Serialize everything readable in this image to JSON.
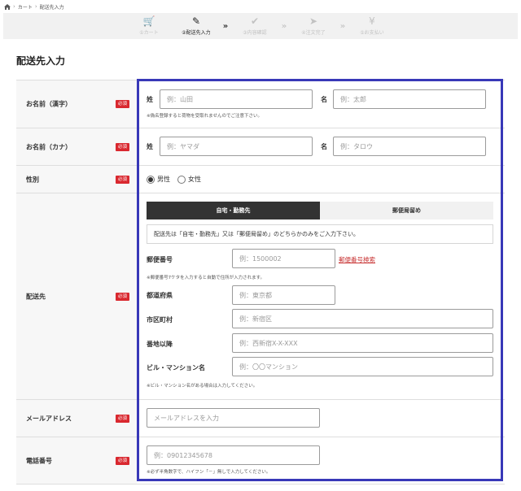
{
  "breadcrumb": {
    "home_icon": "home-icon",
    "cart": "カート",
    "current": "配送先入力"
  },
  "steps": [
    {
      "icon": "cart-icon",
      "glyph": "🛒",
      "label": "①カート"
    },
    {
      "icon": "edit-icon",
      "glyph": "✎",
      "label": "②配送先入力"
    },
    {
      "icon": "check-icon",
      "glyph": "✔",
      "label": "③内容確認"
    },
    {
      "icon": "send-icon",
      "glyph": "➤",
      "label": "④注文完了"
    },
    {
      "icon": "yen-icon",
      "glyph": "¥",
      "label": "⑤お支払い"
    }
  ],
  "page_title": "配送先入力",
  "required_label": "必須",
  "colors": {
    "required": "#d9282f",
    "highlight": "#3838b8",
    "tab_active": "#333333",
    "link": "#c83434"
  },
  "name_kanji": {
    "label": "お名前（漢字）",
    "sei_label": "姓",
    "sei_placeholder": "例：山田",
    "mei_label": "名",
    "mei_placeholder": "例：太郎",
    "note": "※偽名登録すると荷物を受取れませんのでご注意下さい。"
  },
  "name_kana": {
    "label": "お名前（カナ）",
    "sei_label": "姓",
    "sei_placeholder": "例：ヤマダ",
    "mei_label": "名",
    "mei_placeholder": "例：タロウ"
  },
  "gender": {
    "label": "性別",
    "male": "男性",
    "female": "女性",
    "selected": "男性"
  },
  "address": {
    "label": "配送先",
    "tab_home": "自宅・勤務先",
    "tab_post": "郵便局留め",
    "notice": "配送先は「自宅・勤務先」又は「郵便局留め」のどちらかのみをご入力下さい。",
    "zip_label": "郵便番号",
    "zip_placeholder": "例：1500002",
    "zip_link": "郵便番号検索",
    "zip_note": "※郵便番号7ケタを入力すると自動で住所が入力されます。",
    "pref_label": "都道府県",
    "pref_placeholder": "例：東京都",
    "city_label": "市区町村",
    "city_placeholder": "例：新宿区",
    "street_label": "番地以降",
    "street_placeholder": "例：西新宿X-X-XXX",
    "building_label": "ビル・マンション名",
    "building_placeholder": "例：〇〇マンション",
    "building_note": "※ビル・マンション名がある場合は入力してください。"
  },
  "email": {
    "label": "メールアドレス",
    "placeholder": "メールアドレスを入力"
  },
  "phone": {
    "label": "電話番号",
    "placeholder": "例：09012345678",
    "note": "※必ず半角数字で、ハイフン「－」無しで入力してください。"
  }
}
